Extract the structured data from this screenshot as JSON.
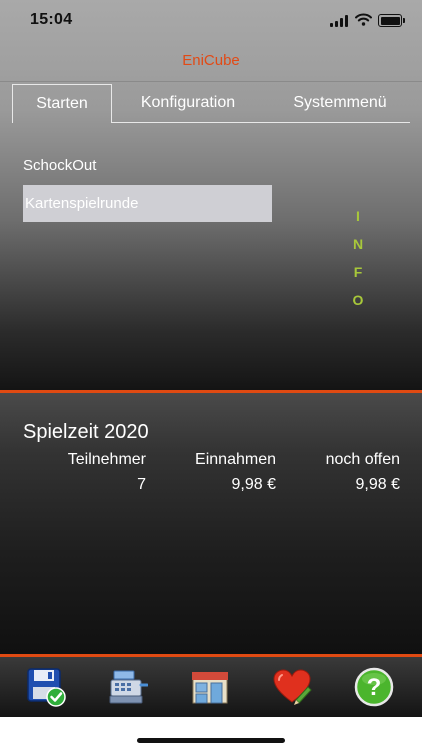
{
  "status": {
    "time": "15:04"
  },
  "app": {
    "title": "EniCube"
  },
  "tabs": [
    {
      "label": "Starten",
      "active": true
    },
    {
      "label": "Konfiguration",
      "active": false
    },
    {
      "label": "Systemmenü",
      "active": false
    }
  ],
  "menu": {
    "items": [
      {
        "label": "SchockOut",
        "selected": false
      },
      {
        "label": "Kartenspielrunde",
        "selected": true
      }
    ]
  },
  "info": {
    "letters": [
      "I",
      "N",
      "F",
      "O"
    ]
  },
  "season": {
    "title": "Spielzeit 2020",
    "columns": [
      "Teilnehmer",
      "Einnahmen",
      "noch offen"
    ],
    "values": [
      "7",
      "9,98 €",
      "9,98 €"
    ]
  },
  "toolbar": {
    "items": [
      {
        "icon": "save-check-icon"
      },
      {
        "icon": "cash-register-icon"
      },
      {
        "icon": "shop-icon"
      },
      {
        "icon": "heart-pencil-icon"
      },
      {
        "icon": "help-icon"
      }
    ]
  },
  "colors": {
    "accent": "#e24a16",
    "info": "#a8c83a",
    "selection": "#cfcfd4",
    "help_green": "#4bb52d"
  }
}
